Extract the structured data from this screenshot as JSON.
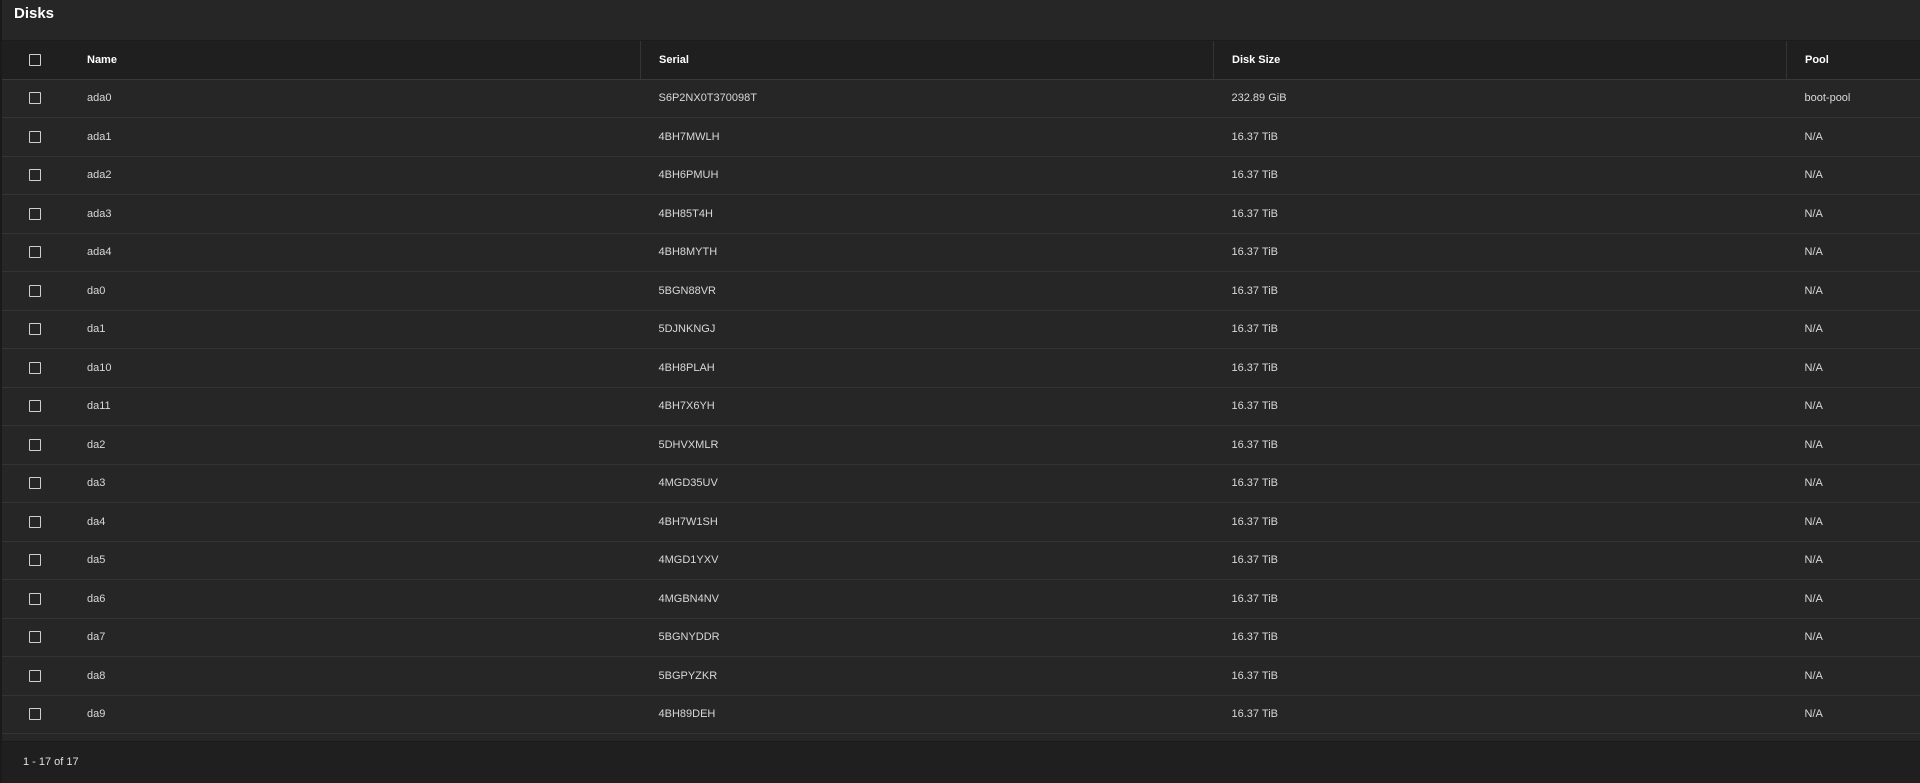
{
  "card": {
    "title": "Disks"
  },
  "table": {
    "columns": [
      "Name",
      "Serial",
      "Disk Size",
      "Pool"
    ],
    "rows": [
      {
        "name": "ada0",
        "serial": "S6P2NX0T370098T",
        "size": "232.89 GiB",
        "pool": "boot-pool"
      },
      {
        "name": "ada1",
        "serial": "4BH7MWLH",
        "size": "16.37 TiB",
        "pool": "N/A"
      },
      {
        "name": "ada2",
        "serial": "4BH6PMUH",
        "size": "16.37 TiB",
        "pool": "N/A"
      },
      {
        "name": "ada3",
        "serial": "4BH85T4H",
        "size": "16.37 TiB",
        "pool": "N/A"
      },
      {
        "name": "ada4",
        "serial": "4BH8MYTH",
        "size": "16.37 TiB",
        "pool": "N/A"
      },
      {
        "name": "da0",
        "serial": "5BGN88VR",
        "size": "16.37 TiB",
        "pool": "N/A"
      },
      {
        "name": "da1",
        "serial": "5DJNKNGJ",
        "size": "16.37 TiB",
        "pool": "N/A"
      },
      {
        "name": "da10",
        "serial": "4BH8PLAH",
        "size": "16.37 TiB",
        "pool": "N/A"
      },
      {
        "name": "da11",
        "serial": "4BH7X6YH",
        "size": "16.37 TiB",
        "pool": "N/A"
      },
      {
        "name": "da2",
        "serial": "5DHVXMLR",
        "size": "16.37 TiB",
        "pool": "N/A"
      },
      {
        "name": "da3",
        "serial": "4MGD35UV",
        "size": "16.37 TiB",
        "pool": "N/A"
      },
      {
        "name": "da4",
        "serial": "4BH7W1SH",
        "size": "16.37 TiB",
        "pool": "N/A"
      },
      {
        "name": "da5",
        "serial": "4MGD1YXV",
        "size": "16.37 TiB",
        "pool": "N/A"
      },
      {
        "name": "da6",
        "serial": "4MGBN4NV",
        "size": "16.37 TiB",
        "pool": "N/A"
      },
      {
        "name": "da7",
        "serial": "5BGNYDDR",
        "size": "16.37 TiB",
        "pool": "N/A"
      },
      {
        "name": "da8",
        "serial": "5BGPYZKR",
        "size": "16.37 TiB",
        "pool": "N/A"
      },
      {
        "name": "da9",
        "serial": "4BH89DEH",
        "size": "16.37 TiB",
        "pool": "N/A"
      }
    ]
  },
  "footer": {
    "range_label": "1 - 17 of 17"
  }
}
